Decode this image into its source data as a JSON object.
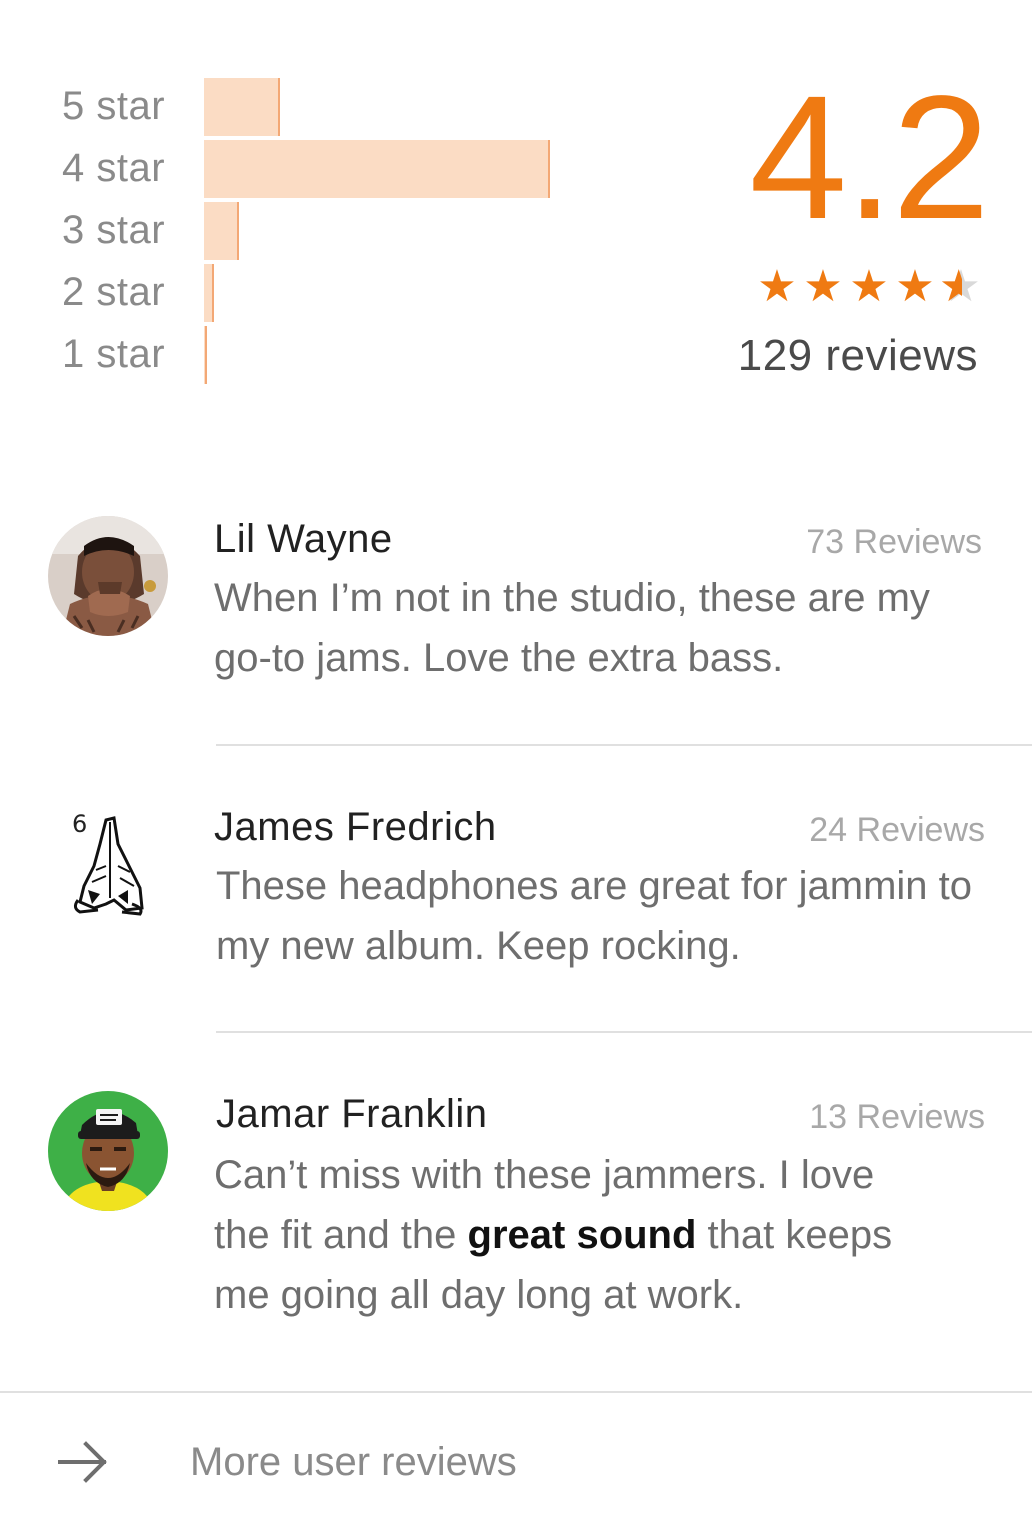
{
  "summary": {
    "average": "4.2",
    "review_count_label": "129 reviews",
    "star_rating": 4.5,
    "accent_color": "#ef7a12",
    "distribution": [
      {
        "label": "5 star",
        "fraction": 0.22
      },
      {
        "label": "4 star",
        "fraction": 1.0
      },
      {
        "label": "3 star",
        "fraction": 0.1
      },
      {
        "label": "2 star",
        "fraction": 0.03
      },
      {
        "label": "1 star",
        "fraction": 0.01
      }
    ]
  },
  "reviews": [
    {
      "name": "Lil Wayne",
      "count_label": "73 Reviews",
      "text": "When I’m not in the studio, these are my go-to jams. Love the extra bass.",
      "avatar_icon": "portrait-photo"
    },
    {
      "name": "James Fredrich",
      "count_label": "24 Reviews",
      "text": "These headphones are great for jammin to my new album. Keep rocking.",
      "avatar_icon": "praying-hands-6-logo",
      "avatar_digit": "6"
    },
    {
      "name": "Jamar Franklin",
      "count_label": "13 Reviews",
      "text_before": "Can’t miss with these jammers. I love the fit and the ",
      "text_highlight": "great sound",
      "text_after": " that keeps me going all day long at work.",
      "avatar_icon": "cartoon-man-with-cap"
    }
  ],
  "footer": {
    "more_label": "More user reviews",
    "icon": "arrow-right-icon"
  }
}
